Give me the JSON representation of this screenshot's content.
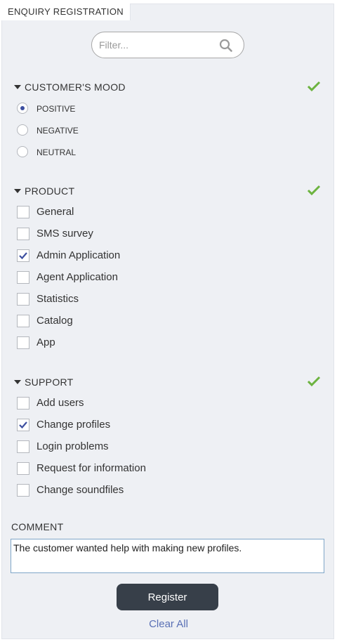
{
  "title": "ENQUIRY REGISTRATION",
  "filter": {
    "placeholder": "Filter...",
    "value": ""
  },
  "sections": {
    "mood": {
      "heading": "CUSTOMER'S MOOD",
      "complete": true,
      "options": [
        {
          "label": "POSITIVE",
          "selected": true
        },
        {
          "label": "NEGATIVE",
          "selected": false
        },
        {
          "label": "NEUTRAL",
          "selected": false
        }
      ]
    },
    "product": {
      "heading": "PRODUCT",
      "complete": true,
      "options": [
        {
          "label": "General",
          "checked": false
        },
        {
          "label": "SMS survey",
          "checked": false
        },
        {
          "label": "Admin Application",
          "checked": true
        },
        {
          "label": "Agent Application",
          "checked": false
        },
        {
          "label": "Statistics",
          "checked": false
        },
        {
          "label": "Catalog",
          "checked": false
        },
        {
          "label": "App",
          "checked": false
        }
      ]
    },
    "support": {
      "heading": "SUPPORT",
      "complete": true,
      "options": [
        {
          "label": "Add users",
          "checked": false
        },
        {
          "label": "Change profiles",
          "checked": true
        },
        {
          "label": "Login problems",
          "checked": false
        },
        {
          "label": "Request for information",
          "checked": false
        },
        {
          "label": "Change soundfiles",
          "checked": false
        }
      ]
    }
  },
  "comment": {
    "label": "COMMENT",
    "value": "The customer wanted help with making new profiles."
  },
  "actions": {
    "register": "Register",
    "clear_all": "Clear All"
  },
  "icons": {
    "search": "search-icon",
    "section_complete": "green-checkmark-icon",
    "collapse": "caret-down-icon"
  },
  "colors": {
    "accent_check": "#6cb33f",
    "selected": "#3d4fa0",
    "button": "#373f49",
    "link": "#5a70b5"
  }
}
